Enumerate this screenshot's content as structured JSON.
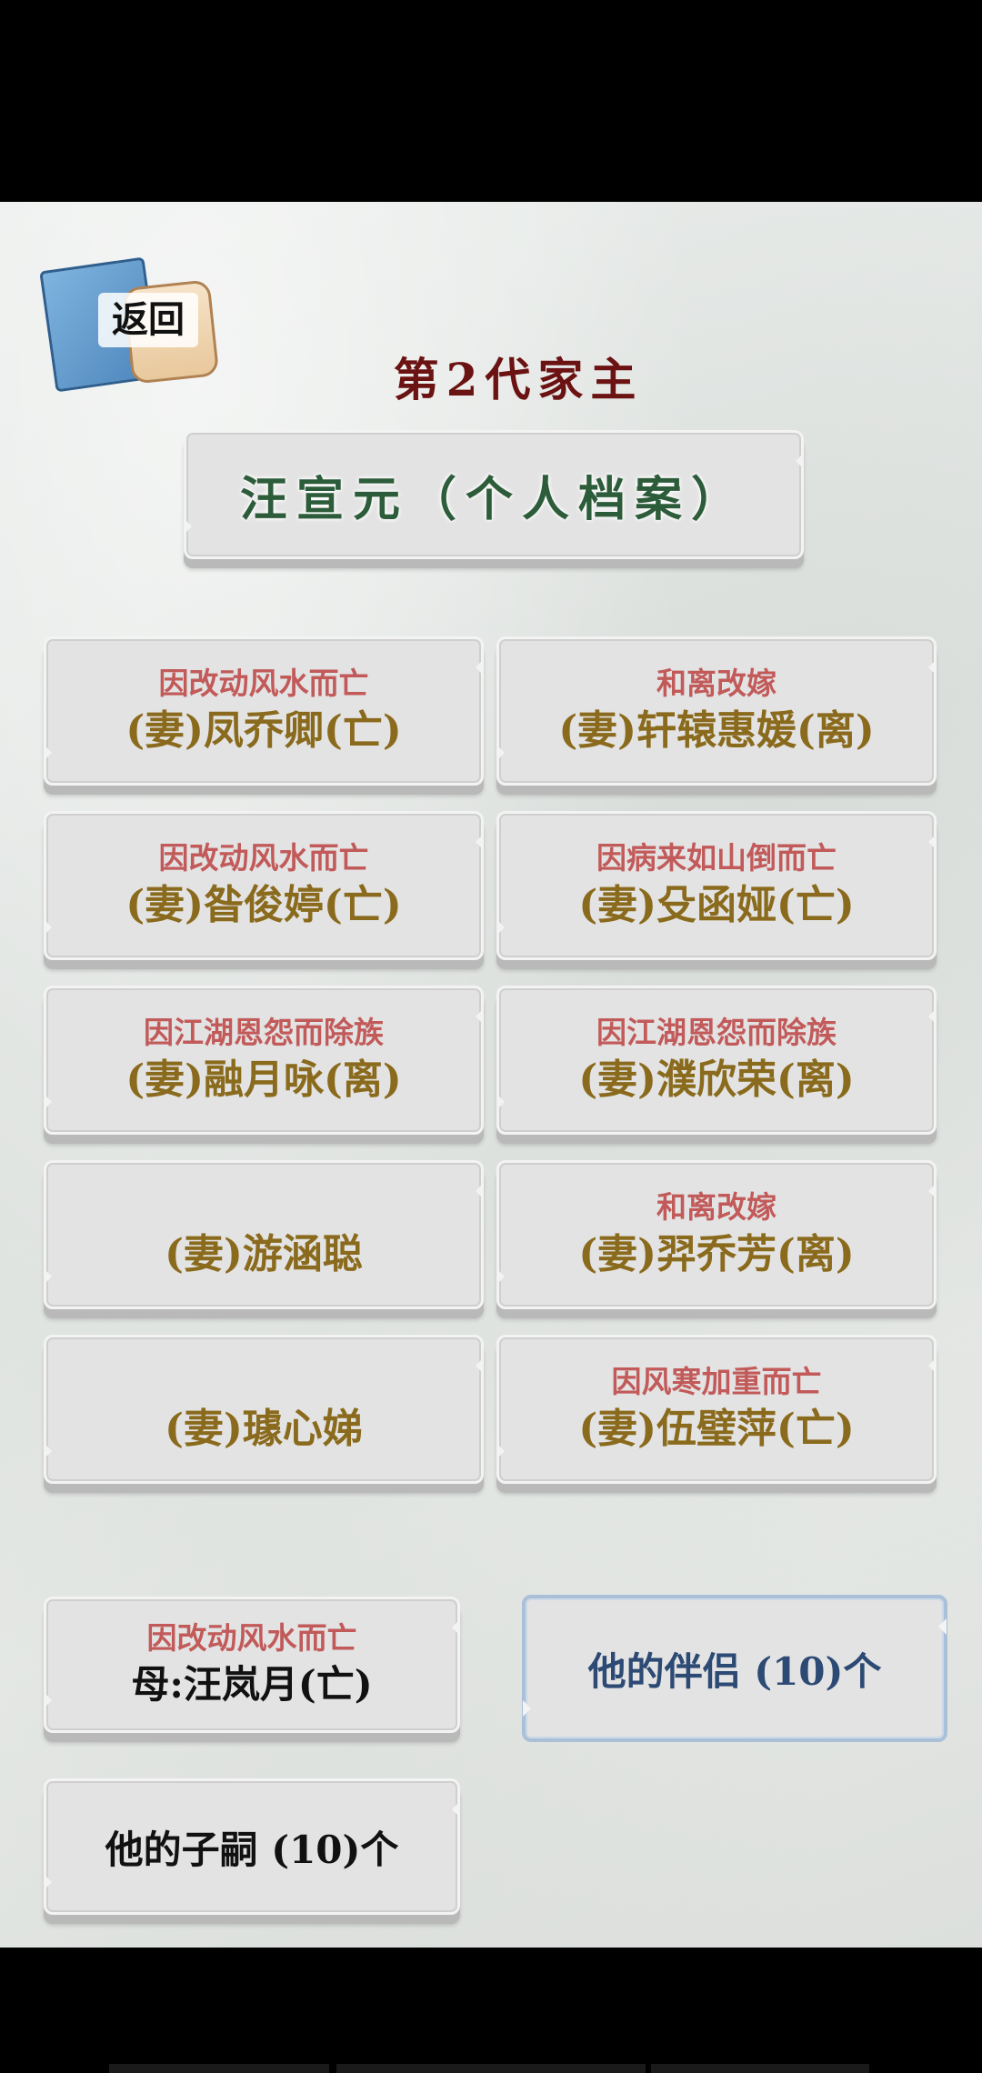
{
  "header": {
    "back_label": "返回",
    "generation_title": "第2代家主",
    "person_title": "汪宣元（个人档案）"
  },
  "spouses": [
    {
      "cause": "因改动风水而亡",
      "name": "(妻)凤乔卿(亡)"
    },
    {
      "cause": "和离改嫁",
      "name": "(妻)轩辕惠媛(离)"
    },
    {
      "cause": "因改动风水而亡",
      "name": "(妻)昝俊婷(亡)"
    },
    {
      "cause": "因病来如山倒而亡",
      "name": "(妻)殳函娅(亡)"
    },
    {
      "cause": "因江湖恩怨而除族",
      "name": "(妻)融月咏(离)"
    },
    {
      "cause": "因江湖恩怨而除族",
      "name": "(妻)濮欣荣(离)"
    },
    {
      "cause": "",
      "name": "(妻)游涵聪"
    },
    {
      "cause": "和离改嫁",
      "name": "(妻)羿乔芳(离)"
    },
    {
      "cause": "",
      "name": "(妻)璩心娣"
    },
    {
      "cause": "因风寒加重而亡",
      "name": "(妻)伍璧萍(亡)"
    }
  ],
  "mother": {
    "cause": "因改动风水而亡",
    "name": "母:汪岚月(亡)"
  },
  "partners_button": "他的伴侣 (10)个",
  "children_button": "他的子嗣 (10)个",
  "colors": {
    "title_red": "#6b1212",
    "name_green": "#2d5c3a",
    "cause_red": "#c25a5a",
    "spouse_gold": "#8a6a1c",
    "partners_blue": "#2c4a74"
  }
}
